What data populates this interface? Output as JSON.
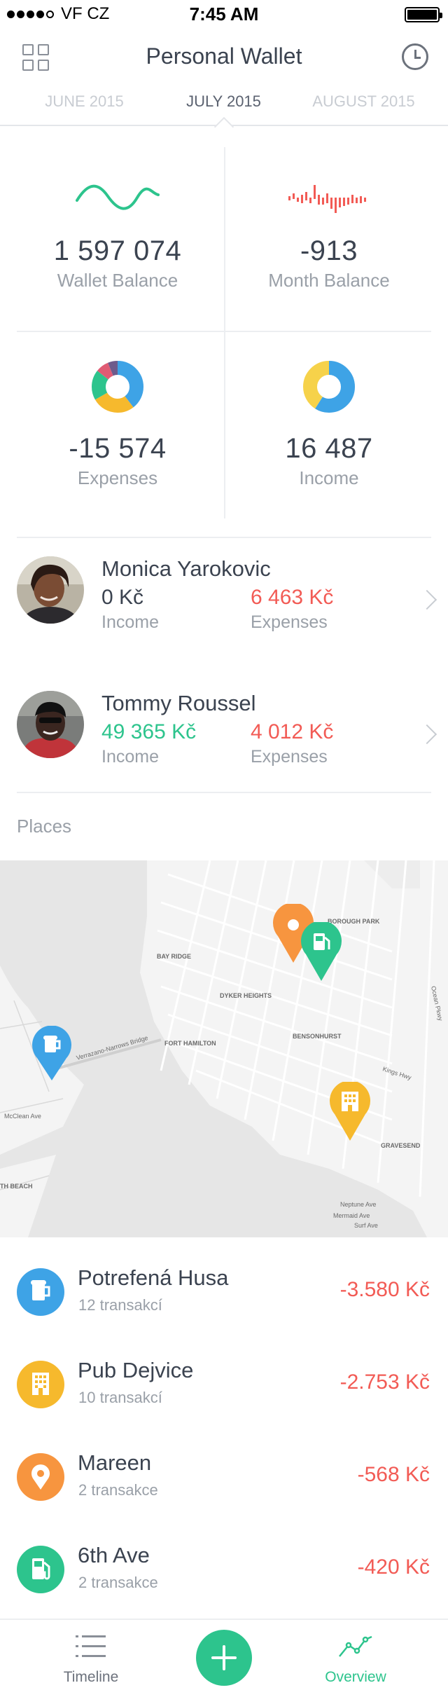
{
  "status_bar": {
    "carrier": "VF CZ",
    "time": "7:45 AM"
  },
  "nav": {
    "title": "Personal Wallet"
  },
  "tabs": [
    {
      "label": "JUNE 2015"
    },
    {
      "label": "JULY 2015"
    },
    {
      "label": "AUGUST 2015"
    }
  ],
  "stats": {
    "wallet_balance": {
      "value": "1 597 074",
      "label": "Wallet Balance"
    },
    "month_balance": {
      "value": "-913",
      "label": "Month Balance"
    },
    "expenses": {
      "value": "-15 574",
      "label": "Expenses"
    },
    "income": {
      "value": "16 487",
      "label": "Income"
    }
  },
  "people": [
    {
      "name": "Monica Yarokovic",
      "income": "0 Kč",
      "income_label": "Income",
      "expenses": "6 463 Kč",
      "expenses_label": "Expenses"
    },
    {
      "name": "Tommy Roussel",
      "income": "49 365 Kč",
      "income_label": "Income",
      "expenses": "4 012 Kč",
      "expenses_label": "Expenses"
    }
  ],
  "places_label": "Places",
  "map_labels": {
    "verrazano": "Verrazano-Narrows Bridge",
    "bay_ridge": "BAY RIDGE",
    "dyker": "DYKER HEIGHTS",
    "fort_hamilton": "FORT HAMILTON",
    "bensonhurst": "BENSONHURST",
    "borough_park": "BOROUGH PARK",
    "gravesend": "GRAVESEND",
    "neptune": "Neptune Ave",
    "mermaid": "Mermaid Ave",
    "surf": "Surf Ave",
    "beach": "TH BEACH",
    "mcclean": "McClean Ave",
    "ocean_pkwy": "Ocean Pkwy",
    "kings_hwy": "Kings Hwy"
  },
  "places": [
    {
      "name": "Potrefená Husa",
      "sub": "12 transakcí",
      "amount": "-3.580 Kč",
      "icon": "beer-mug-icon",
      "color": "#3ea3e6"
    },
    {
      "name": "Pub Dejvice",
      "sub": "10 transakcí",
      "amount": "-2.753 Kč",
      "icon": "building-icon",
      "color": "#f6b92d"
    },
    {
      "name": "Mareen",
      "sub": "2 transakce",
      "amount": "-568 Kč",
      "icon": "location-pin-icon",
      "color": "#f7953f"
    },
    {
      "name": "6th Ave",
      "sub": "2 transakce",
      "amount": "-420 Kč",
      "icon": "fuel-pump-icon",
      "color": "#2dc48d"
    }
  ],
  "tab_bar": {
    "timeline": "Timeline",
    "overview": "Overview"
  },
  "colors": {
    "accent_green": "#2dc48d",
    "negative_red": "#f25b55",
    "blue": "#3ea3e6",
    "yellow": "#f6b92d",
    "orange": "#f7953f"
  }
}
